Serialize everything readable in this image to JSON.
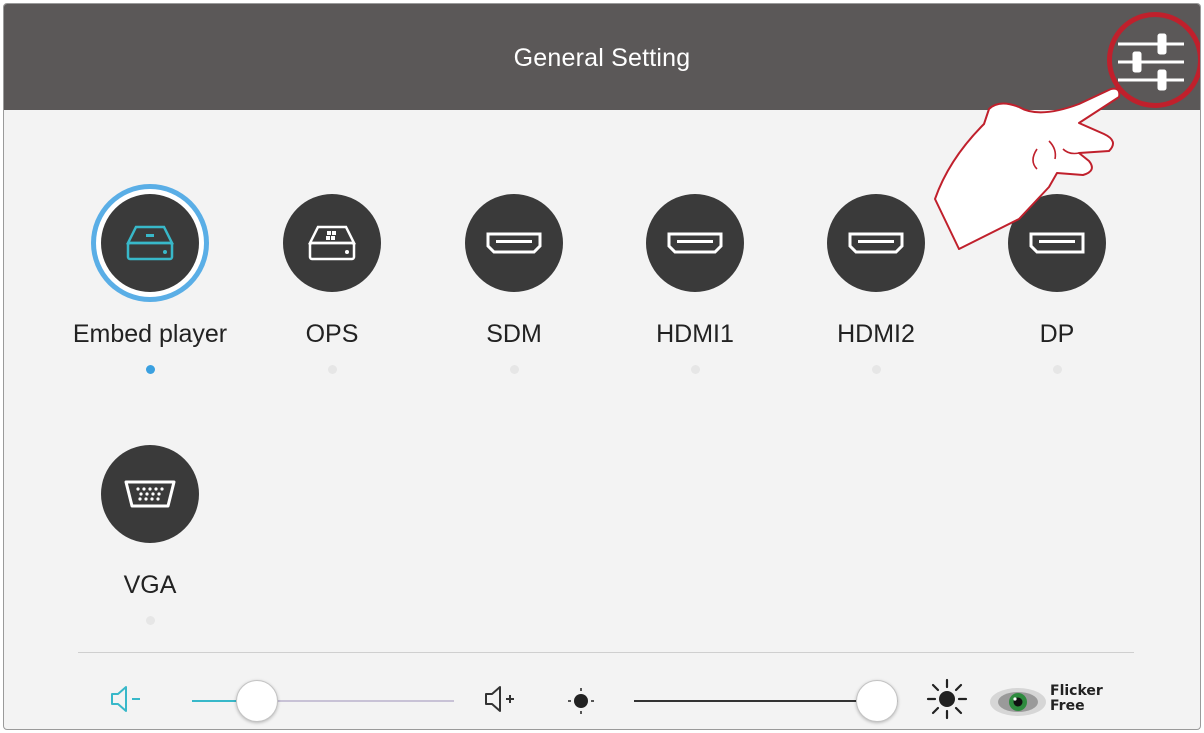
{
  "header": {
    "title": "General Setting"
  },
  "sources": [
    {
      "label": "Embed player",
      "icon": "media-player-icon",
      "selected": true
    },
    {
      "label": "OPS",
      "icon": "ops-icon",
      "selected": false
    },
    {
      "label": "SDM",
      "icon": "hdmi-port-icon",
      "selected": false
    },
    {
      "label": "HDMI1",
      "icon": "hdmi-port-icon",
      "selected": false
    },
    {
      "label": "HDMI2",
      "icon": "hdmi-port-icon",
      "selected": false
    },
    {
      "label": "DP",
      "icon": "displayport-icon",
      "selected": false
    },
    {
      "label": "VGA",
      "icon": "vga-port-icon",
      "selected": false
    }
  ],
  "controls": {
    "volume_level": 0.2,
    "brightness_level": 1.0,
    "flicker_free_line1": "Flicker",
    "flicker_free_line2": "Free"
  },
  "colors": {
    "accent": "#38b8c9",
    "selection_ring": "#5aaee6",
    "highlight": "#c0202c",
    "header": "#5b5858"
  }
}
